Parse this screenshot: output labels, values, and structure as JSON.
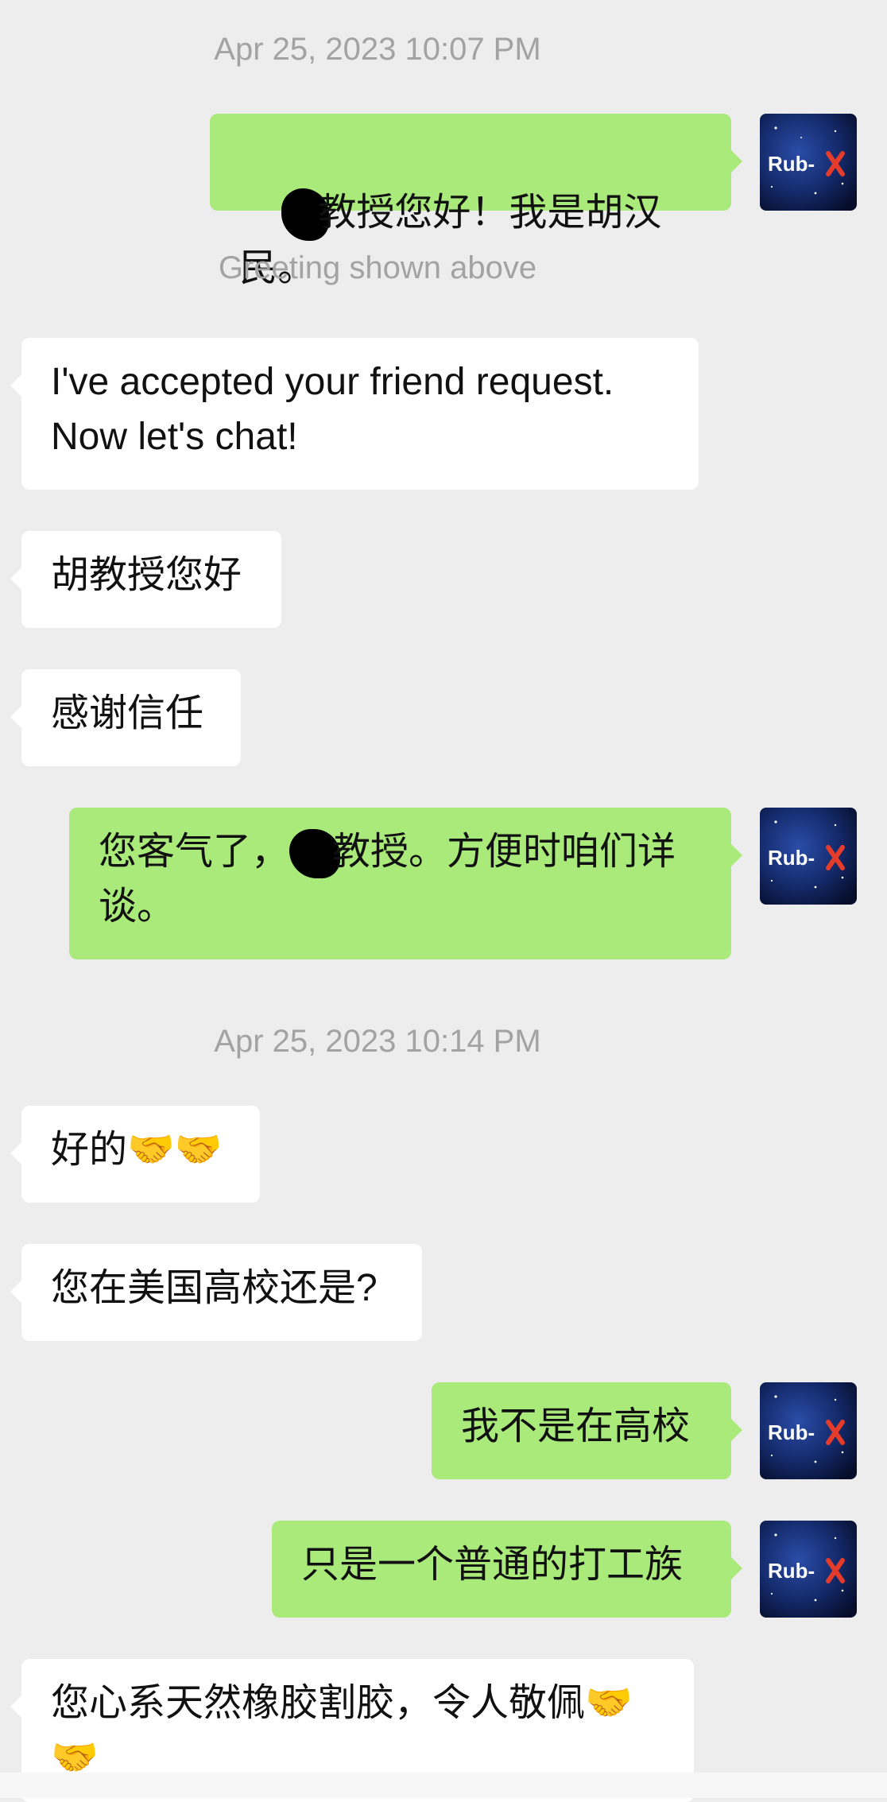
{
  "chat": {
    "timestamp_1": "Apr 25, 2023 10:07 PM",
    "timestamp_2": "Apr 25, 2023 10:14 PM",
    "system_note": "Greeting shown above",
    "avatar_label": "Rub-X",
    "messages": [
      {
        "from": "me",
        "text": "教授您好！我是胡汉民。"
      },
      {
        "from": "them",
        "text": "I've accepted your friend request. Now let's chat!"
      },
      {
        "from": "them",
        "text": "胡教授您好"
      },
      {
        "from": "them",
        "text": "感谢信任"
      },
      {
        "from": "me",
        "text_before": "您客气了，",
        "text_after": "教授。方便时咱们详谈。"
      },
      {
        "from": "them",
        "text": "好的🤝🤝"
      },
      {
        "from": "them",
        "text": "您在美国高校还是?"
      },
      {
        "from": "me",
        "text": "我不是在高校"
      },
      {
        "from": "me",
        "text": "只是一个普通的打工族"
      },
      {
        "from": "them",
        "text": "您心系天然橡胶割胶，令人敬佩🤝🤝"
      }
    ]
  },
  "colors": {
    "background": "#EDEDED",
    "sent_bubble": "#A9EA7A",
    "received_bubble": "#FFFFFF",
    "timestamp": "#A3A3A3"
  }
}
